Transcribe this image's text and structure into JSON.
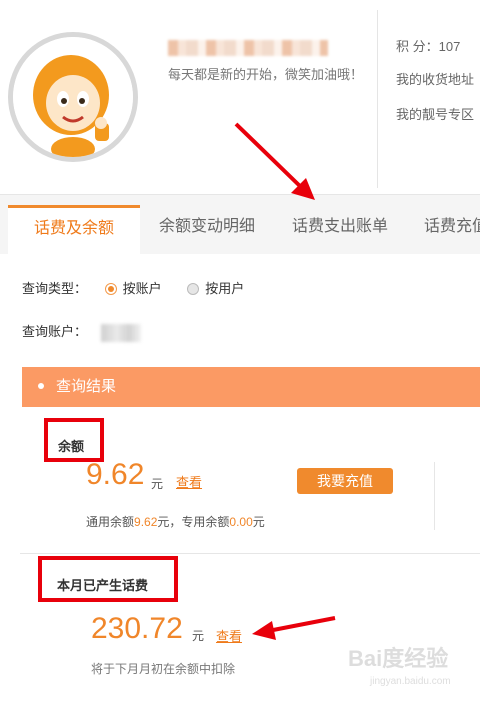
{
  "profile": {
    "motto": "每天都是新的开始，微笑加油哦！",
    "side_links": {
      "points_label": "积  分：",
      "points_value": "107",
      "address": "我的收货地址",
      "number_zone": "我的靓号专区"
    }
  },
  "tabs": [
    {
      "label": "话费及余额",
      "active": true
    },
    {
      "label": "余额变动明细",
      "active": false
    },
    {
      "label": "话费支出账单",
      "active": false
    },
    {
      "label": "话费充值",
      "active": false
    }
  ],
  "query": {
    "type_label": "查询类型：",
    "options": [
      {
        "label": "按账户",
        "checked": true
      },
      {
        "label": "按用户",
        "checked": false
      }
    ],
    "account_label": "查询账户："
  },
  "result": {
    "header": "查询结果",
    "balance": {
      "label": "余额",
      "amount": "9.62",
      "unit": "元",
      "view_link": "查看",
      "recharge_button": "我要充值",
      "detail_prefix": "通用余额",
      "general_balance": "9.62",
      "detail_mid": "元，专用余额",
      "special_balance": "0.00",
      "detail_suffix": "元"
    },
    "month_fee": {
      "label": "本月已产生话费",
      "amount": "230.72",
      "unit": "元",
      "view_link": "查看",
      "note": "将于下月月初在余额中扣除"
    }
  },
  "watermark": {
    "text": "Bai度经验",
    "sub": "jingyan.baidu.com"
  },
  "colors": {
    "accent": "#f08a2d",
    "result_bar": "#fb9a64",
    "annotation_red": "#e8000b"
  }
}
